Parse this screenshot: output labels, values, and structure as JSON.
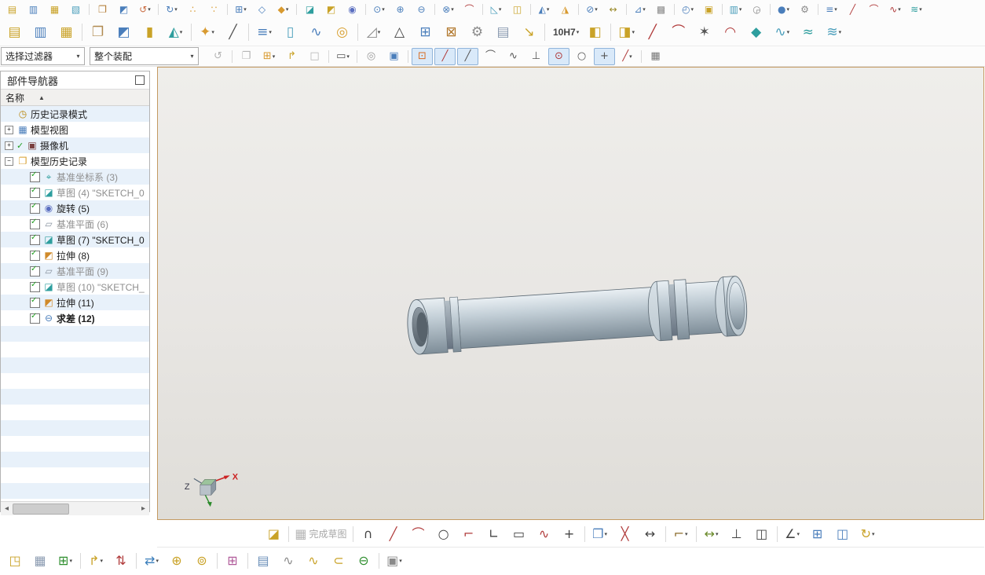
{
  "ui_colors": {
    "row_stripe": "#e8f1fa",
    "viewport_border": "#c49a62",
    "pressed_bg": "#d9e9f9"
  },
  "toolbar_row1": {
    "items": [
      {
        "name": "new",
        "glyph": "▤",
        "color": "#c9a227"
      },
      {
        "name": "open",
        "glyph": "▥",
        "color": "#4a7ebb"
      },
      {
        "name": "save",
        "glyph": "▦",
        "color": "#c9a227"
      },
      {
        "name": "save-as",
        "glyph": "▧",
        "color": "#4a9ebb"
      },
      {
        "name": "copy",
        "glyph": "❐",
        "color": "#b07830",
        "sep": true
      },
      {
        "name": "paste",
        "glyph": "◩",
        "color": "#4a7ebb"
      },
      {
        "name": "undo",
        "glyph": "↺",
        "color": "#c96a3f",
        "caret": true
      },
      {
        "name": "redo",
        "glyph": "↻",
        "color": "#4a7ebb",
        "caret": true,
        "sep": true
      },
      {
        "name": "pattern-dots",
        "glyph": "∴",
        "color": "#d89a30"
      },
      {
        "name": "pattern-dots-2",
        "glyph": "∵",
        "color": "#d89a30"
      },
      {
        "name": "pattern-grid",
        "glyph": "⊞",
        "color": "#4a7ebb",
        "caret": true,
        "sep": true
      },
      {
        "name": "datum-plane",
        "glyph": "◇",
        "color": "#4a7ebb"
      },
      {
        "name": "datum-axis",
        "glyph": "◆",
        "color": "#d89a30",
        "caret": true
      },
      {
        "name": "sketch",
        "glyph": "◪",
        "color": "#2e9e9e",
        "sep": true
      },
      {
        "name": "extrude",
        "glyph": "◩",
        "color": "#c9a227"
      },
      {
        "name": "revolve",
        "glyph": "◉",
        "color": "#5a6ec0"
      },
      {
        "name": "hole",
        "glyph": "⊙",
        "color": "#4a7ebb",
        "caret": true,
        "sep": true
      },
      {
        "name": "unite",
        "glyph": "⊕",
        "color": "#4a7ebb"
      },
      {
        "name": "subtract",
        "glyph": "⊖",
        "color": "#4a7ebb"
      },
      {
        "name": "intersect",
        "glyph": "⊗",
        "color": "#4a7ebb",
        "caret": true,
        "sep": true
      },
      {
        "name": "edge-blend",
        "glyph": "⌒",
        "color": "#b03a3a"
      },
      {
        "name": "chamfer",
        "glyph": "◺",
        "color": "#4a9ebb",
        "caret": true,
        "sep": true
      },
      {
        "name": "shell",
        "glyph": "◫",
        "color": "#c9a227"
      },
      {
        "name": "draft",
        "glyph": "◭",
        "color": "#4a7ebb",
        "caret": true,
        "sep": true
      },
      {
        "name": "trim-body",
        "glyph": "◮",
        "color": "#d89a30"
      },
      {
        "name": "split-body",
        "glyph": "⊘",
        "color": "#4a7ebb",
        "caret": true,
        "sep": true
      },
      {
        "name": "measure",
        "glyph": "↔",
        "color": "#9a8a2a"
      },
      {
        "name": "analysis",
        "glyph": "⊿",
        "color": "#4a7ebb",
        "caret": true,
        "sep": true
      },
      {
        "name": "layer-settings",
        "glyph": "▩",
        "color": "#8a8a8a"
      },
      {
        "name": "display-mode",
        "glyph": "◴",
        "color": "#4a7ebb",
        "caret": true,
        "sep": true
      },
      {
        "name": "window",
        "glyph": "▣",
        "color": "#c9a227"
      },
      {
        "name": "layout",
        "glyph": "▥",
        "color": "#4a9ebb",
        "caret": true,
        "sep": true
      },
      {
        "name": "snapshot",
        "glyph": "◶",
        "color": "#8a8a8a"
      },
      {
        "name": "render-style",
        "glyph": "●",
        "color": "#4a7ebb",
        "caret": true,
        "sep": true
      },
      {
        "name": "tools",
        "glyph": "⚙",
        "color": "#8a8a8a"
      },
      {
        "name": "menu-list",
        "glyph": "≡",
        "color": "#4a7ebb",
        "caret": true,
        "sep": true
      },
      {
        "name": "curve-line",
        "glyph": "╱",
        "color": "#b03a3a"
      },
      {
        "name": "curve-arc",
        "glyph": "⌒",
        "color": "#b03a3a"
      },
      {
        "name": "curve-spline",
        "glyph": "∿",
        "color": "#b03a3a",
        "caret": true
      },
      {
        "name": "surface",
        "glyph": "≋",
        "color": "#2e9e9e",
        "caret": true
      }
    ]
  },
  "toolbar_row2": {
    "items": [
      {
        "name": "layer-sheet-1",
        "glyph": "▤",
        "color": "#c9a227"
      },
      {
        "name": "layer-sheet-2",
        "glyph": "▥",
        "color": "#4a7ebb"
      },
      {
        "name": "layer-sheet-3",
        "glyph": "▦",
        "color": "#c9a227"
      },
      {
        "name": "journal",
        "glyph": "❐",
        "color": "#b08a50",
        "sep": true
      },
      {
        "name": "block",
        "glyph": "◩",
        "color": "#4a7ebb"
      },
      {
        "name": "cylinder",
        "glyph": "▮",
        "color": "#c9a227"
      },
      {
        "name": "cone",
        "glyph": "◭",
        "color": "#2e9e9e",
        "caret": true
      },
      {
        "name": "pattern-feature",
        "glyph": "✦",
        "color": "#d89a30",
        "caret": true,
        "sep": true
      },
      {
        "name": "delete-face",
        "glyph": "╱",
        "color": "#555555"
      },
      {
        "name": "synchronous-modeling",
        "glyph": "≡",
        "color": "#4a7ebb",
        "caret": true,
        "sep": true
      },
      {
        "name": "tube",
        "glyph": "▯",
        "color": "#4a9ebb"
      },
      {
        "name": "spring",
        "glyph": "∿",
        "color": "#4a7ebb"
      },
      {
        "name": "washer",
        "glyph": "◎",
        "color": "#d8a030"
      },
      {
        "name": "rib",
        "glyph": "◿",
        "color": "#8a8a8a",
        "caret": true,
        "sep": true
      },
      {
        "name": "triangle-mesh",
        "glyph": "△",
        "color": "#444444"
      },
      {
        "name": "table",
        "glyph": "⊞",
        "color": "#4a7ebb"
      },
      {
        "name": "forming-tool",
        "glyph": "⊠",
        "color": "#b0762a"
      },
      {
        "name": "gears",
        "glyph": "⚙",
        "color": "#8a8a8a"
      },
      {
        "name": "notes-sheet",
        "glyph": "▤",
        "color": "#8a9ab0"
      },
      {
        "name": "leader-dimension",
        "glyph": "↘",
        "color": "#c9a227"
      },
      {
        "name": "tolerance",
        "label": "10H7",
        "bold": true,
        "caret": true,
        "sep": true
      },
      {
        "name": "cube-a",
        "glyph": "◧",
        "color": "#c9a227"
      },
      {
        "name": "cube-b",
        "glyph": "◨",
        "color": "#c9a227",
        "caret": true,
        "sep": true
      },
      {
        "name": "line-curve",
        "glyph": "╱",
        "color": "#b03a3a"
      },
      {
        "name": "arc-curve",
        "glyph": "⌒",
        "color": "#b03a3a"
      },
      {
        "name": "point-cloud",
        "glyph": "✶",
        "color": "#555555"
      },
      {
        "name": "conic",
        "glyph": "◠",
        "color": "#b03a3a"
      },
      {
        "name": "text-curve",
        "glyph": "◆",
        "color": "#2e9e9e"
      },
      {
        "name": "helix",
        "glyph": "∿",
        "color": "#4a9ebb",
        "caret": true
      },
      {
        "name": "sweep-surface",
        "glyph": "≈",
        "color": "#2e9e9e"
      },
      {
        "name": "swoop-surface",
        "glyph": "≋",
        "color": "#4a9ebb",
        "caret": true
      }
    ]
  },
  "filter_bar": {
    "selector_value": "选择过滤器",
    "scope_value": "整个装配",
    "icons": [
      {
        "name": "filter-reset",
        "glyph": "↺",
        "color": "#aaaaaa",
        "disabled": true
      },
      {
        "name": "clipboard",
        "glyph": "❐",
        "color": "#aaaaaa",
        "disabled": true,
        "sep": true
      },
      {
        "name": "group-add",
        "glyph": "⊞",
        "color": "#d89a30",
        "caret": true
      },
      {
        "name": "promote",
        "glyph": "↱",
        "color": "#c9a227"
      },
      {
        "name": "ghost-box",
        "glyph": "□",
        "color": "#aaaaaa",
        "disabled": true
      },
      {
        "name": "marquee-select",
        "glyph": "▭",
        "color": "#555555",
        "caret": true,
        "sep": true
      },
      {
        "name": "washer-gray",
        "glyph": "◎",
        "color": "#999999",
        "sep": true
      },
      {
        "name": "cube-blue",
        "glyph": "▣",
        "color": "#4a7ebb"
      },
      {
        "name": "snap-point",
        "glyph": "⊡",
        "color": "#d86a20",
        "pressed": true,
        "sep": true
      },
      {
        "name": "snap-endpoint",
        "glyph": "╱",
        "color": "#b03a3a",
        "pressed": true
      },
      {
        "name": "snap-midpoint",
        "glyph": "╱",
        "color": "#555555",
        "pressed": true
      },
      {
        "name": "snap-knot",
        "glyph": "⌒",
        "color": "#555555"
      },
      {
        "name": "snap-pole",
        "glyph": "∿",
        "color": "#555555"
      },
      {
        "name": "snap-intersection",
        "glyph": "⊥",
        "color": "#555555"
      },
      {
        "name": "snap-arc-center",
        "glyph": "⊙",
        "color": "#b03a3a",
        "pressed": true
      },
      {
        "name": "snap-quadrant",
        "glyph": "○",
        "color": "#555555"
      },
      {
        "name": "snap-existing-point",
        "glyph": "+",
        "color": "#555555",
        "pressed": true
      },
      {
        "name": "snap-point-on-curve",
        "glyph": "╱",
        "color": "#b03a3a",
        "caret": true
      },
      {
        "name": "grid-display",
        "glyph": "▦",
        "color": "#777777",
        "sep": true
      }
    ]
  },
  "navigator": {
    "title": "部件导航器",
    "column_header": "名称",
    "sort_indicator": "▲",
    "items": [
      {
        "id": "history-mode",
        "label": "历史记录模式",
        "icon": "history-mode",
        "indent": 0,
        "expander": null,
        "pre": null
      },
      {
        "id": "model-views",
        "label": "模型视图",
        "icon": "model-views",
        "indent": 0,
        "expander": "plus",
        "pre": null
      },
      {
        "id": "cameras",
        "label": "摄像机",
        "icon": "cameras",
        "indent": 0,
        "expander": "plus",
        "pre": "check"
      },
      {
        "id": "model-history",
        "label": "模型历史记录",
        "icon": "history-folder",
        "indent": 0,
        "expander": "minus",
        "pre": null
      },
      {
        "id": "datum-csys-3",
        "label": "基准坐标系 (3)",
        "icon": "datum-csys",
        "indent": 1,
        "pre": "checkbox",
        "muted": true
      },
      {
        "id": "sketch-4",
        "label": "草图 (4) \"SKETCH_0",
        "icon": "sketch",
        "indent": 1,
        "pre": "checkbox",
        "muted": true
      },
      {
        "id": "revolve-5",
        "label": "旋转 (5)",
        "icon": "revolve",
        "indent": 1,
        "pre": "checkbox"
      },
      {
        "id": "datum-plane-6",
        "label": "基准平面 (6)",
        "icon": "datum-plane",
        "indent": 1,
        "pre": "checkbox",
        "muted": true
      },
      {
        "id": "sketch-7",
        "label": "草图 (7) \"SKETCH_0",
        "icon": "sketch",
        "indent": 1,
        "pre": "checkbox"
      },
      {
        "id": "extrude-8",
        "label": "拉伸 (8)",
        "icon": "extrude",
        "indent": 1,
        "pre": "checkbox"
      },
      {
        "id": "datum-plane-9",
        "label": "基准平面 (9)",
        "icon": "datum-plane",
        "indent": 1,
        "pre": "checkbox",
        "muted": true
      },
      {
        "id": "sketch-10",
        "label": "草图 (10) \"SKETCH_",
        "icon": "sketch",
        "indent": 1,
        "pre": "checkbox",
        "muted": true
      },
      {
        "id": "extrude-11",
        "label": "拉伸 (11)",
        "icon": "extrude",
        "indent": 1,
        "pre": "checkbox"
      },
      {
        "id": "subtract-12",
        "label": "求差 (12)",
        "icon": "subtract",
        "indent": 1,
        "pre": "checkbox",
        "bold": true
      }
    ]
  },
  "viewport": {
    "triad": {
      "x_label": "X",
      "z_label": "Z"
    },
    "model": {
      "body_light": "#e9eff3",
      "body_mid": "#c3cfd7",
      "body_dark": "#7e8d98",
      "groove_light": "#b4bfc7",
      "groove_dark": "#667280",
      "face_light": "#d9e2e8",
      "face_mid": "#bac6ce",
      "bore_light": "#8e99a2",
      "bore_dark": "#57626b"
    }
  },
  "sketch_toolbar": {
    "items": [
      {
        "name": "sketch-task",
        "glyph": "◪",
        "color": "#c9a227"
      },
      {
        "name": "finish-sketch",
        "glyph": "▦",
        "color": "#9aa4ae",
        "label": "完成草图",
        "disabled": true,
        "sep": true
      },
      {
        "name": "profile",
        "glyph": "∩",
        "color": "#444444",
        "sep": true
      },
      {
        "name": "line",
        "glyph": "╱",
        "color": "#b03a3a"
      },
      {
        "name": "arc",
        "glyph": "⌒",
        "color": "#b03a3a"
      },
      {
        "name": "circle",
        "glyph": "○",
        "color": "#444444"
      },
      {
        "name": "fillet",
        "glyph": "⌐",
        "color": "#b03a3a"
      },
      {
        "name": "chamfer-sketch",
        "glyph": "∟",
        "color": "#444444"
      },
      {
        "name": "rectangle",
        "glyph": "▭",
        "color": "#444444"
      },
      {
        "name": "studio-spline",
        "glyph": "∿",
        "color": "#b03a3a"
      },
      {
        "name": "point",
        "glyph": "+",
        "color": "#444444"
      },
      {
        "name": "offset-curve",
        "glyph": "❐",
        "color": "#4a7ebb",
        "caret": true,
        "sep": true
      },
      {
        "name": "quick-trim",
        "glyph": "╳",
        "color": "#b03a3a"
      },
      {
        "name": "quick-extend",
        "glyph": "↔",
        "color": "#444444"
      },
      {
        "name": "make-corner",
        "glyph": "⌐",
        "color": "#8a6a2a",
        "caret": true,
        "sep": true
      },
      {
        "name": "rapid-dimension",
        "glyph": "↔",
        "color": "#6a8a2a",
        "caret": true,
        "sep": true
      },
      {
        "name": "geometric-constraints",
        "glyph": "⊥",
        "color": "#444444"
      },
      {
        "name": "show-constraints",
        "glyph": "◫",
        "color": "#444444"
      },
      {
        "name": "constraint-angle",
        "glyph": "∠",
        "color": "#444444",
        "caret": true,
        "sep": true
      },
      {
        "name": "pattern-curve",
        "glyph": "⊞",
        "color": "#4a7ebb"
      },
      {
        "name": "mirror-curve",
        "glyph": "◫",
        "color": "#4a7ebb"
      },
      {
        "name": "reattach",
        "glyph": "↻",
        "color": "#c9a227",
        "caret": true
      }
    ]
  },
  "assembly_toolbar": {
    "items": [
      {
        "name": "exploded-views",
        "glyph": "◳",
        "color": "#c9a227"
      },
      {
        "name": "assembly-grid",
        "glyph": "▦",
        "color": "#8a9ab0"
      },
      {
        "name": "add-component",
        "glyph": "⊞",
        "color": "#2e8e2e",
        "caret": true
      },
      {
        "name": "new-parent",
        "glyph": "↱",
        "color": "#c9a227",
        "caret": true,
        "sep": true
      },
      {
        "name": "move-component",
        "glyph": "⇅",
        "color": "#b03a3a"
      },
      {
        "name": "assembly-constraints",
        "glyph": "⇄",
        "color": "#3a7ebb",
        "caret": true,
        "sep": true
      },
      {
        "name": "reference-set",
        "glyph": "⊕",
        "color": "#c9a227"
      },
      {
        "name": "pattern-component",
        "glyph": "⊚",
        "color": "#c9a227"
      },
      {
        "name": "component-family",
        "glyph": "⊞",
        "color": "#b05a9a",
        "sep": true
      },
      {
        "name": "wave-sheet",
        "glyph": "▤",
        "color": "#6a8eb8",
        "sep": true
      },
      {
        "name": "coil-gray",
        "glyph": "∿",
        "color": "#8a8a8a"
      },
      {
        "name": "coil-gold",
        "glyph": "∿",
        "color": "#c9a227"
      },
      {
        "name": "clip",
        "glyph": "⊂",
        "color": "#c9a227"
      },
      {
        "name": "wave-link",
        "glyph": "⊖",
        "color": "#2e8e2e"
      },
      {
        "name": "product-outline",
        "glyph": "▣",
        "color": "#8a8a8a",
        "caret": true,
        "sep": true
      }
    ]
  },
  "icon_glyphs": {
    "history-mode": {
      "glyph": "◷",
      "color": "#b8860b"
    },
    "model-views": {
      "glyph": "▦",
      "color": "#4a7ebb"
    },
    "cameras": {
      "glyph": "▣",
      "color": "#7a4040"
    },
    "history-folder": {
      "glyph": "❐",
      "color": "#d8a030"
    },
    "datum-csys": {
      "glyph": "⌖",
      "color": "#2e9e9e"
    },
    "sketch": {
      "glyph": "◪",
      "color": "#2e9e9e"
    },
    "revolve": {
      "glyph": "◉",
      "color": "#5a6ec0"
    },
    "datum-plane": {
      "glyph": "▱",
      "color": "#8a94a0"
    },
    "extrude": {
      "glyph": "◩",
      "color": "#d08a2a"
    },
    "subtract": {
      "glyph": "⊖",
      "color": "#4a7ebb"
    }
  }
}
